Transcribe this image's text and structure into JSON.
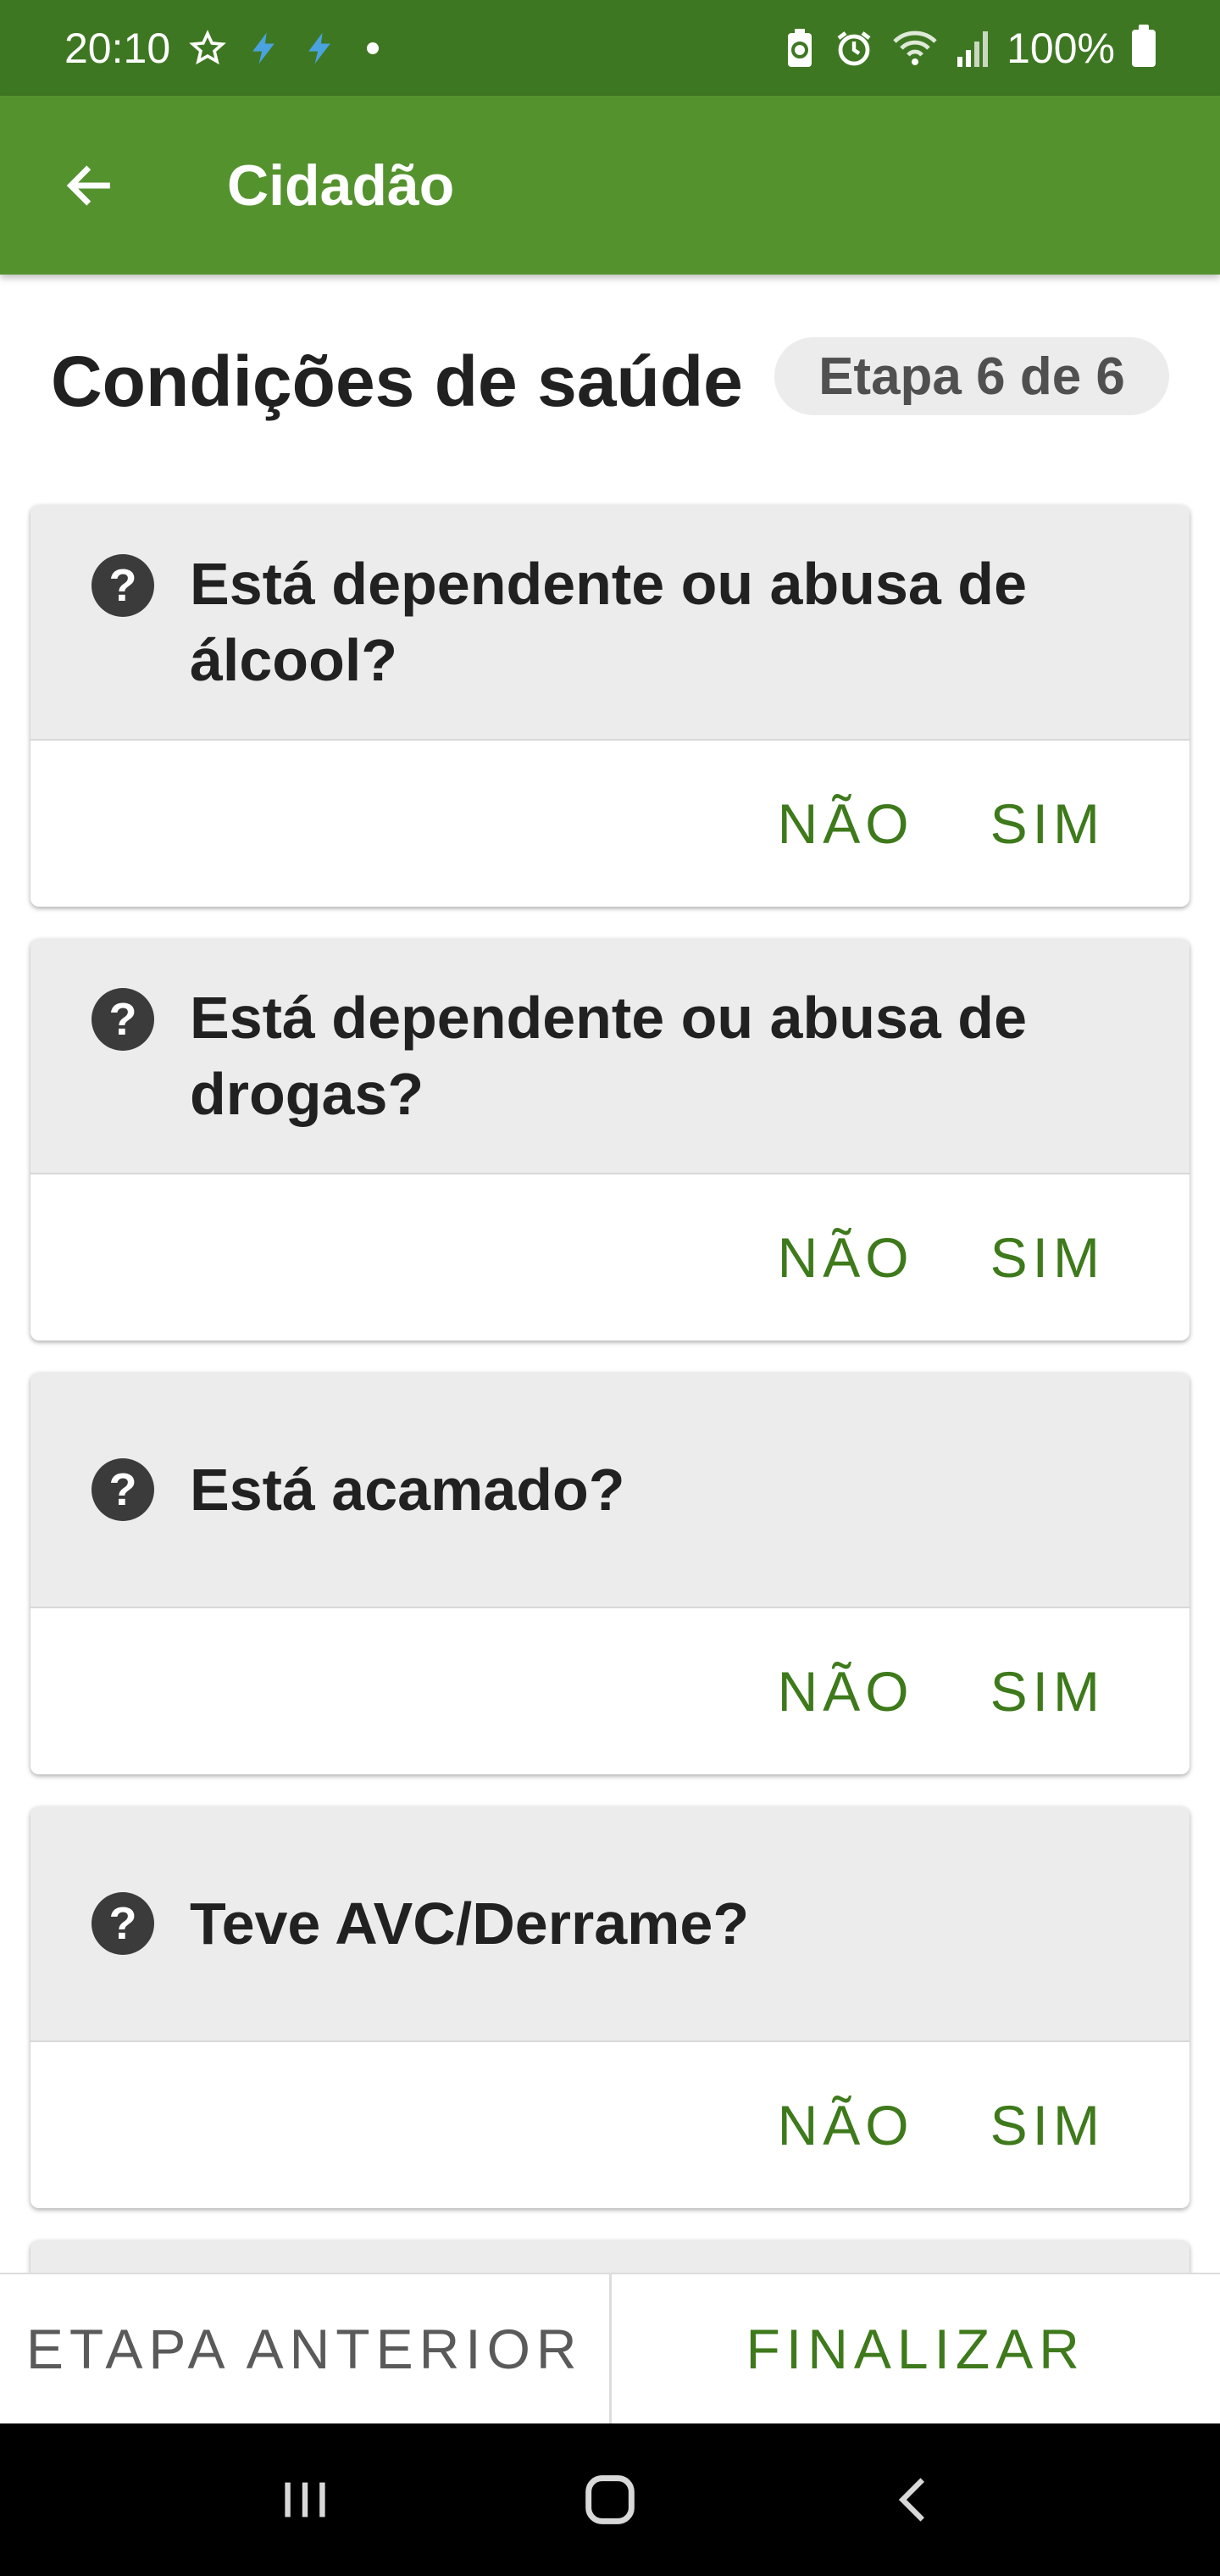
{
  "status_bar": {
    "time": "20:10",
    "battery_percent": "100%",
    "icons": [
      "star-icon",
      "bolt-icon",
      "bolt-icon",
      "dot-icon",
      "battery-saver-icon",
      "alarm-icon",
      "wifi-icon",
      "signal-icon",
      "battery-icon"
    ]
  },
  "app_bar": {
    "title": "Cidadão",
    "back_icon": "arrow-left-icon"
  },
  "header": {
    "title": "Condições de saúde",
    "step": "Etapa 6 de 6"
  },
  "questions": [
    {
      "text_line1": "Está dependente ou abusa de",
      "text_line2": "álcool?",
      "no_label": "NÃO",
      "yes_label": "SIM"
    },
    {
      "text_line1": "Está dependente ou abusa de",
      "text_line2": "drogas?",
      "no_label": "NÃO",
      "yes_label": "SIM"
    },
    {
      "text_line1": "Está acamado?",
      "text_line2": "",
      "no_label": "NÃO",
      "yes_label": "SIM"
    },
    {
      "text_line1": "Teve AVC/Derrame?",
      "text_line2": "",
      "no_label": "NÃO",
      "yes_label": "SIM"
    }
  ],
  "help_glyph": "?",
  "bottom_bar": {
    "prev_label": "ETAPA ANTERIOR",
    "finish_label": "FINALIZAR"
  },
  "colors": {
    "status_bar": "#3e7722",
    "app_bar": "#54922e",
    "accent": "#3e7a1b"
  }
}
